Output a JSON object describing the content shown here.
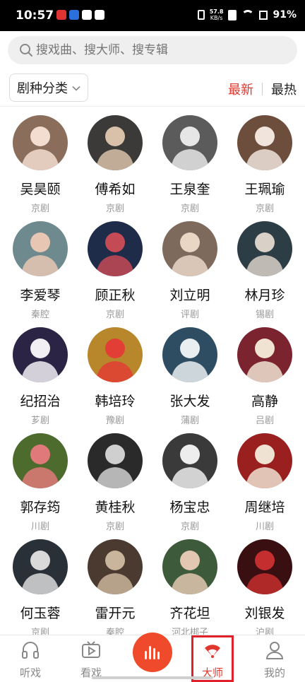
{
  "status": {
    "time": "10:57",
    "net_speed_value": "57.8",
    "net_speed_unit": "KB/s",
    "battery": "91%"
  },
  "search": {
    "placeholder": "搜戏曲、搜大师、搜专辑"
  },
  "filter": {
    "genre_label": "剧种分类",
    "sort_latest": "最新",
    "sort_hot": "最热",
    "accent_color": "#e0382e"
  },
  "artists": [
    {
      "name": "吴昊颐",
      "genre": "京剧"
    },
    {
      "name": "傅希如",
      "genre": "京剧"
    },
    {
      "name": "王泉奎",
      "genre": "京剧"
    },
    {
      "name": "王珮瑜",
      "genre": "京剧"
    },
    {
      "name": "李爱琴",
      "genre": "秦腔"
    },
    {
      "name": "顾正秋",
      "genre": "京剧"
    },
    {
      "name": "刘立明",
      "genre": "评剧"
    },
    {
      "name": "林月珍",
      "genre": "锡剧"
    },
    {
      "name": "纪招治",
      "genre": "芗剧"
    },
    {
      "name": "韩培玲",
      "genre": "豫剧"
    },
    {
      "name": "张大发",
      "genre": "蒲剧"
    },
    {
      "name": "高静",
      "genre": "吕剧"
    },
    {
      "name": "郭存筠",
      "genre": "川剧"
    },
    {
      "name": "黄桂秋",
      "genre": "京剧"
    },
    {
      "name": "杨宝忠",
      "genre": "京剧"
    },
    {
      "name": "周继培",
      "genre": "川剧"
    },
    {
      "name": "何玉蓉",
      "genre": "京剧"
    },
    {
      "name": "雷开元",
      "genre": "秦腔"
    },
    {
      "name": "齐花坦",
      "genre": "河北梆子"
    },
    {
      "name": "刘银发",
      "genre": "沪剧"
    }
  ],
  "nav": {
    "listen": "听戏",
    "watch": "看戏",
    "masters": "大师",
    "mine": "我的",
    "active": "masters"
  }
}
